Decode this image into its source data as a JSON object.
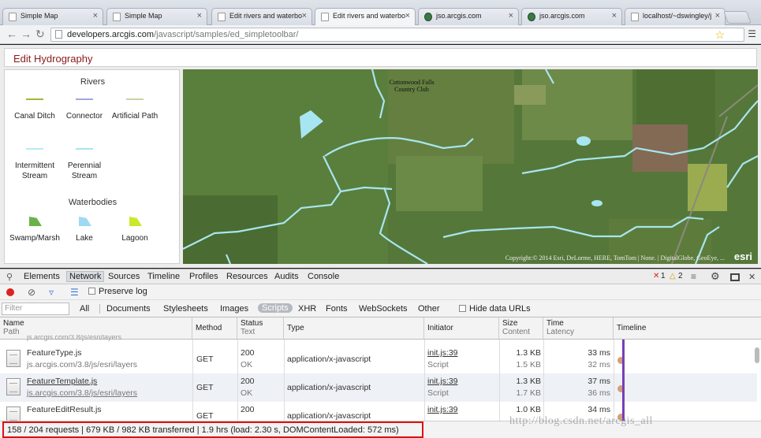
{
  "browser": {
    "tabs": [
      {
        "label": "Simple Map",
        "active": false,
        "globe": false
      },
      {
        "label": "Simple Map",
        "active": false,
        "globe": false
      },
      {
        "label": "Edit rivers and waterbo",
        "active": false,
        "globe": false
      },
      {
        "label": "Edit rivers and waterbo",
        "active": true,
        "globe": false
      },
      {
        "label": "jso.arcgis.com",
        "active": false,
        "globe": true
      },
      {
        "label": "jso.arcgis.com",
        "active": false,
        "globe": true
      },
      {
        "label": "localhost/~dswingley/j",
        "active": false,
        "globe": false
      }
    ],
    "url_host": "developers.arcgis.com",
    "url_path": "/javascript/samples/ed_simpletoolbar/"
  },
  "page": {
    "title": "Edit Hydrography",
    "legend": {
      "rivers_heading": "Rivers",
      "waterbodies_heading": "Waterbodies",
      "rivers": [
        {
          "label": "Canal Ditch",
          "color": "#a8b43a"
        },
        {
          "label": "Connector",
          "color": "#9ea9e0"
        },
        {
          "label": "Artificial Path",
          "color": "#c9d4a7"
        },
        {
          "label": "Intermittent Stream",
          "color": "#b6eef0"
        },
        {
          "label": "Perennial Stream",
          "color": "#a7e6ee"
        }
      ],
      "waterbodies": [
        {
          "label": "Swamp/Marsh",
          "color": "#6bb24a"
        },
        {
          "label": "Lake",
          "color": "#9fd9f4"
        },
        {
          "label": "Lagoon",
          "color": "#c8ea2a"
        }
      ]
    },
    "map": {
      "place_label": "Cottonwood Falls Country Club",
      "attribution": "Copyright:© 2014 Esri, DeLorme, HERE, TomTom | None. | DigitalGlobe, GeoEye, ...",
      "logo": "esri"
    }
  },
  "devtools": {
    "tabs": [
      "Elements",
      "Network",
      "Sources",
      "Timeline",
      "Profiles",
      "Resources",
      "Audits",
      "Console"
    ],
    "selected_tab": "Network",
    "error_count": "1",
    "warning_count": "2",
    "preserve_log": "Preserve log",
    "filter_placeholder": "Filter",
    "filter_types": [
      "All",
      "Documents",
      "Stylesheets",
      "Images",
      "Scripts",
      "XHR",
      "Fonts",
      "WebSockets",
      "Other"
    ],
    "selected_filter": "Scripts",
    "hide_data_urls": "Hide data URLs",
    "columns": {
      "name": "Name",
      "path": "Path",
      "method": "Method",
      "status": "Status",
      "status_sub": "Text",
      "type": "Type",
      "initiator": "Initiator",
      "size": "Size",
      "size_sub": "Content",
      "time": "Time",
      "time_sub": "Latency",
      "timeline": "Timeline"
    },
    "partial_row_path": "js.arcgis.com/3.8/js/esri/layers",
    "rows": [
      {
        "name": "FeatureType.js",
        "path": "js.arcgis.com/3.8/js/esri/layers",
        "method": "GET",
        "status": "200",
        "status_text": "OK",
        "type": "application/x-javascript",
        "initiator": "init.js:39",
        "initiator_type": "Script",
        "size": "1.3 KB",
        "content": "1.5 KB",
        "time": "33 ms",
        "latency": "32 ms"
      },
      {
        "name": "FeatureTemplate.js",
        "path": "js.arcgis.com/3.8/js/esri/layers",
        "method": "GET",
        "status": "200",
        "status_text": "OK",
        "type": "application/x-javascript",
        "initiator": "init.js:39",
        "initiator_type": "Script",
        "size": "1.3 KB",
        "content": "1.7 KB",
        "time": "37 ms",
        "latency": "36 ms"
      },
      {
        "name": "FeatureEditResult.js",
        "path": "",
        "method": "GET",
        "status": "200",
        "status_text": "",
        "type": "application/x-javascript",
        "initiator": "init.js:39",
        "initiator_type": "",
        "size": "1.0 KB",
        "content": "",
        "time": "34 ms",
        "latency": ""
      }
    ],
    "status_bar": "158 / 204 requests | 679 KB / 982 KB transferred | 1.9 hrs (load: 2.30 s, DOMContentLoaded: 572 ms)"
  },
  "watermark": "http://blog.csdn.net/arcgis_all"
}
